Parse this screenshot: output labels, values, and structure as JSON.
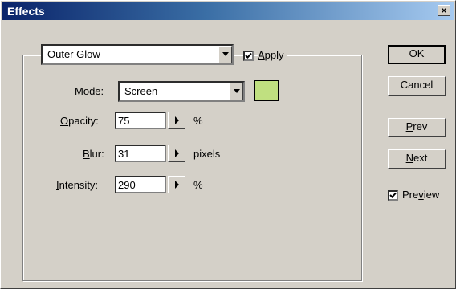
{
  "window": {
    "title": "Effects",
    "close_label": "×"
  },
  "effect": {
    "selected": "Outer Glow"
  },
  "apply": {
    "label_pre": "",
    "label_u": "A",
    "label_post": "pply",
    "checked": true
  },
  "mode": {
    "label_u": "M",
    "label_post": "ode:",
    "selected": "Screen",
    "color": "#c0e080"
  },
  "opacity": {
    "label_u": "O",
    "label_post": "pacity:",
    "value": "75",
    "unit": "%"
  },
  "blur": {
    "label_u": "B",
    "label_post": "lur:",
    "value": "31",
    "unit": "pixels"
  },
  "intensity": {
    "label_u": "I",
    "label_post": "ntensity:",
    "value": "290",
    "unit": "%"
  },
  "buttons": {
    "ok": "OK",
    "cancel": "Cancel",
    "prev_u": "P",
    "prev_post": "rev",
    "next_u": "N",
    "next_post": "ext"
  },
  "preview": {
    "label_pre": "Pre",
    "label_u": "v",
    "label_post": "iew",
    "checked": true
  }
}
